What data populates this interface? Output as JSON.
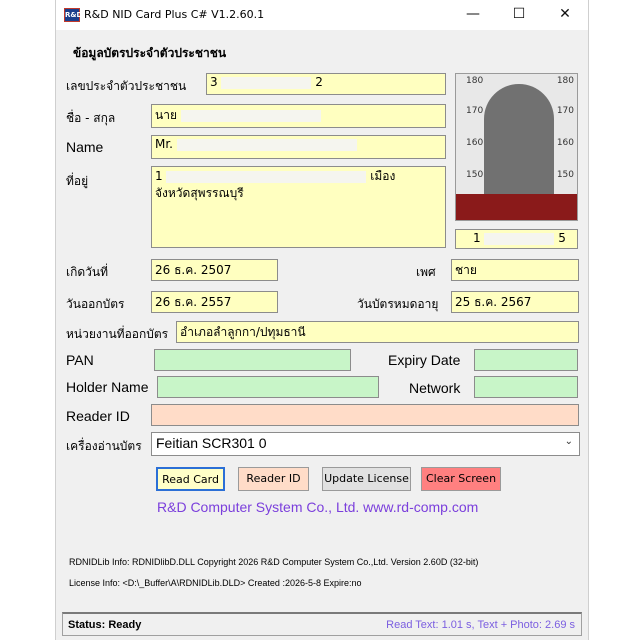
{
  "window": {
    "title": "R&D NID Card Plus C# V1.2.60.1",
    "icon_text": "R&D",
    "minimize": "—",
    "maximize": "☐",
    "close": "✕"
  },
  "form": {
    "section_title": "ข้อมูลบัตรประจำตัวประชาชน",
    "id_label": "เลขประจำตัวประชาชน",
    "id_value_start": "3",
    "id_value_end": "2",
    "name_th_label": "ชื่อ - สกุล",
    "name_th_value": "นาย",
    "name_en_label": "Name",
    "name_en_value": "Mr. ",
    "address_label": "ที่อยู่",
    "address_line1_start": "1",
    "address_line1_end": "เมือง",
    "address_line2": "จังหวัดสุพรรณบุรี",
    "photo_number_start": "1",
    "photo_number_end": "5",
    "birth_label": "เกิดวันที่",
    "birth_value": "26 ธ.ค. 2507",
    "gender_label": "เพศ",
    "gender_value": "ชาย",
    "issue_label": "วันออกบัตร",
    "issue_value": "26 ธ.ค. 2557",
    "expire_label": "วันบัตรหมดอายุ",
    "expire_value": "25 ธ.ค. 2567",
    "issuer_label": "หน่วยงานที่ออกบัตร",
    "issuer_value": "อำเภอลำลูกกา/ปทุมธานี",
    "pan_label": "PAN",
    "expiry_date_label": "Expiry Date",
    "holder_label": "Holder Name",
    "network_label": "Network",
    "reader_id_label": "Reader ID",
    "reader_label": "เครื่องอ่านบัตร",
    "reader_value": "Feitian SCR301 0"
  },
  "photo": {
    "ruler_180": "180",
    "ruler_170": "170",
    "ruler_160": "160",
    "ruler_150": "150"
  },
  "buttons": {
    "read_card": "Read Card",
    "reader_id": "Reader ID",
    "update_license": "Update License",
    "clear_screen": "Clear Screen"
  },
  "company": "R&D Computer System Co., Ltd.  www.rd-comp.com",
  "info": {
    "lib_info": "RDNIDLib Info: RDNIDlibD.DLL Copyright 2026 R&D Computer System Co.,Ltd. Version 2.60D (32-bit)",
    "license_info": "License Info: <D:\\_Buffer\\A\\RDNIDLib.DLD> Created :2026-5-8 Expire:no"
  },
  "status": {
    "left": "Status: Ready",
    "right": "Read Text: 1.01 s, Text + Photo: 2.69 s"
  },
  "colors": {
    "field_yellow": "#ffffc0",
    "field_green": "#c8f5c8",
    "field_orange": "#ffdcc8",
    "clear_red": "#ff8080",
    "accent_purple": "#7b3fdc"
  }
}
